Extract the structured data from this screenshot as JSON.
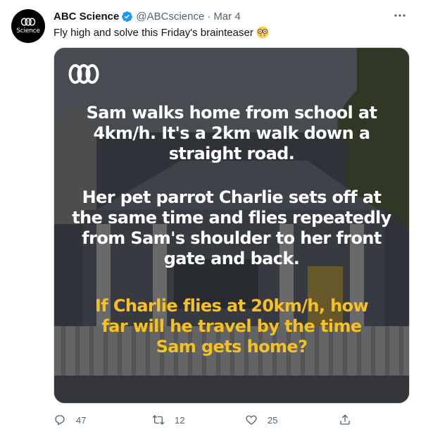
{
  "tweet": {
    "avatar_text": "Science",
    "name": "ABC Science",
    "handle": "@ABCscience",
    "separator": "·",
    "date": "Mar 4",
    "text": "Fly high and solve this Friday's brainteaser",
    "emoji": "nerd-face-emoji"
  },
  "image": {
    "paragraph1": "Sam walks home from school at 4km/h. It's a 2km walk down a straight road.",
    "paragraph2": "Her pet parrot Charlie sets off at the same time and flies repeatedly from Sam's shoulder to her front gate and back.",
    "paragraph3": "If Charlie flies at 20km/h, how far will he travel by the time Sam gets home?",
    "text_color": "#ffffff",
    "highlight_color": "#f7c21f"
  },
  "actions": {
    "replies": "47",
    "retweets": "12",
    "likes": "25"
  },
  "colors": {
    "text_primary": "#0f1419",
    "text_secondary": "#536471",
    "verified": "#1d9bf0"
  }
}
